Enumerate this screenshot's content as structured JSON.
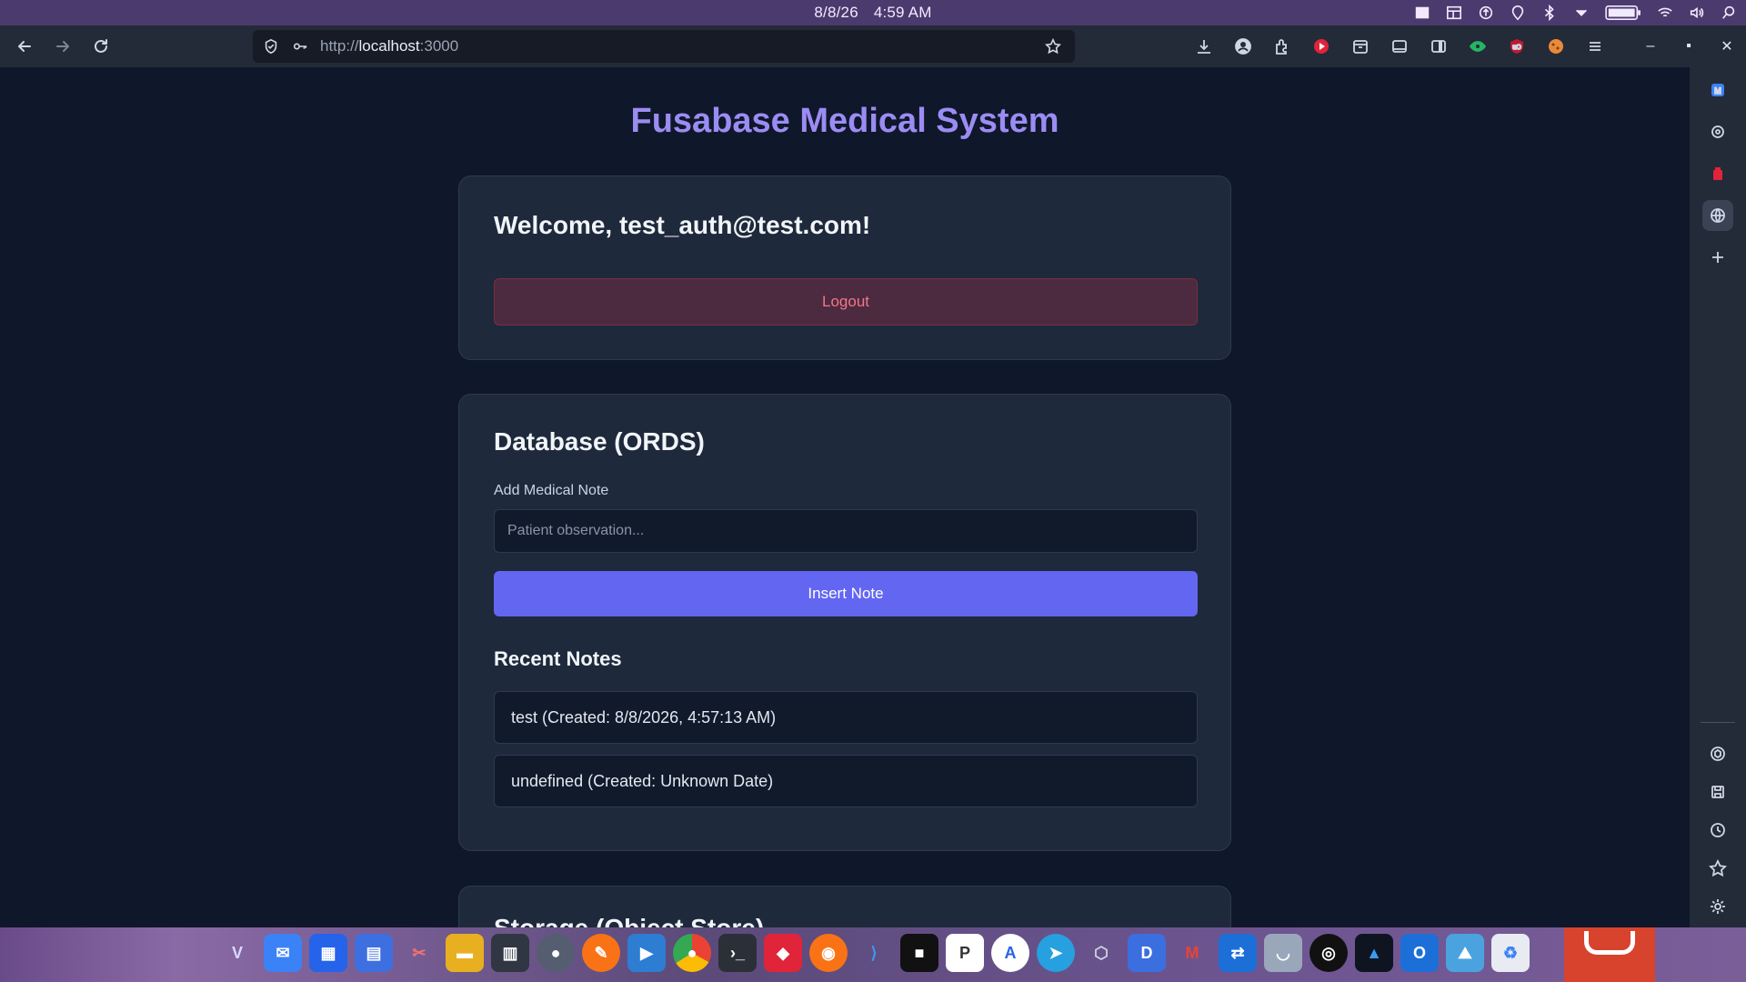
{
  "os": {
    "date": "8/8/26",
    "time": "4:59 AM",
    "tray_icons": [
      "window-icon",
      "layout-icon",
      "upload-icon",
      "location-icon",
      "bluetooth-icon",
      "chevron-down-icon",
      "battery-icon",
      "wifi-icon",
      "volume-icon",
      "search-icon"
    ]
  },
  "browser": {
    "url_prefix": "http://",
    "url_host": "localhost",
    "url_port": ":3000",
    "extensions": [
      "download-icon",
      "account-icon",
      "extensions-icon",
      "youtube-icon",
      "archive-icon",
      "tab-icon",
      "sidebar-icon",
      "eye-icon",
      "ublock-icon",
      "cookie-icon",
      "menu-icon"
    ]
  },
  "sidepanel": {
    "items": [
      "mastodon-icon",
      "ai-icon",
      "trash-icon",
      "globe-icon",
      "plus-icon",
      "chatgpt-icon",
      "save-icon",
      "history-icon",
      "bookmark-icon",
      "settings-icon"
    ]
  },
  "page": {
    "title": "Fusabase Medical System",
    "auth_card": {
      "welcome": "Welcome, test_auth@test.com!",
      "logout_label": "Logout"
    },
    "db_card": {
      "title": "Database (ORDS)",
      "field_label": "Add Medical Note",
      "input_placeholder": "Patient observation...",
      "input_value": "",
      "insert_label": "Insert Note",
      "recent_title": "Recent Notes",
      "notes": [
        "test (Created: 8/8/2026, 4:57:13 AM)",
        "undefined (Created: Unknown Date)"
      ]
    },
    "storage_card": {
      "title": "Storage (Object Store)"
    }
  },
  "dock": {
    "apps": [
      "vivaldi",
      "mail",
      "store",
      "calendar",
      "tools",
      "files",
      "terminal-panel",
      "obs",
      "pen",
      "finder",
      "chrome",
      "terminal",
      "git",
      "firefox",
      "vscode",
      "cube",
      "postgres",
      "appstore",
      "telegram",
      "virtualbox",
      "docs",
      "gmail",
      "remote",
      "ghost",
      "steam",
      "arch",
      "outlook",
      "photos",
      "recycle"
    ]
  },
  "colors": {
    "accent": "#6366f1",
    "title": "#9b8cf3",
    "danger": "#f0778a",
    "card": "#1e293b",
    "background": "#0f172a"
  }
}
